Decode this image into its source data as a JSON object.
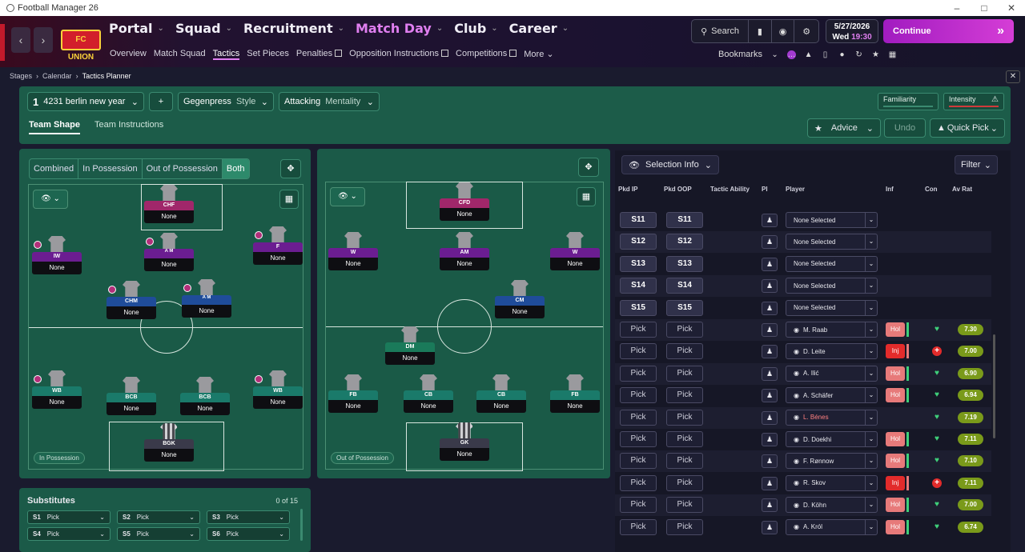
{
  "window": {
    "title": "Football Manager 26"
  },
  "main_menu": [
    {
      "label": "Portal",
      "active": false
    },
    {
      "label": "Squad",
      "active": false
    },
    {
      "label": "Recruitment",
      "active": false
    },
    {
      "label": "Match Day",
      "active": true
    },
    {
      "label": "Club",
      "active": false
    },
    {
      "label": "Career",
      "active": false
    }
  ],
  "club_logo_text": "FC UNION",
  "sub_menu": [
    "Overview",
    "Match Squad",
    "Tactics",
    "Set Pieces",
    "Penalties",
    "Opposition Instructions",
    "Competitions",
    "More"
  ],
  "search_label": "Search",
  "date": {
    "date": "5/27/2026",
    "day": "Wed",
    "time": "19:30"
  },
  "continue_label": "Continue",
  "bookmarks_label": "Bookmarks",
  "breadcrumb": [
    "Stages",
    "Calendar",
    "Tactics Planner"
  ],
  "tactic": {
    "slot": "1",
    "name": "4231 berlin new year",
    "style": "Gegenpress",
    "style_label": "Style",
    "mentality": "Attacking",
    "mentality_label": "Mentality",
    "familiarity_label": "Familiarity",
    "intensity_label": "Intensity"
  },
  "tabs": [
    "Team Shape",
    "Team Instructions"
  ],
  "advice_label": "Advice",
  "undo_label": "Undo",
  "quick_pick_label": "Quick Pick",
  "modes": [
    "Combined",
    "In Possession",
    "Out of Possession",
    "Both"
  ],
  "pitch1": {
    "tag": "In Possession",
    "positions": [
      {
        "role": "CHF",
        "player": "None",
        "color": "#a0276a",
        "dot": false
      },
      {
        "role": "IW",
        "player": "None",
        "color": "#6b1d91",
        "dot": true
      },
      {
        "role": "A\nM",
        "player": "None",
        "color": "#6b1d91",
        "dot": true
      },
      {
        "role": "F",
        "player": "None",
        "color": "#6b1d91",
        "dot": true
      },
      {
        "role": "CHM",
        "player": "None",
        "color": "#1f4c9a",
        "dot": true
      },
      {
        "role": "A\nM",
        "player": "None",
        "color": "#1f4c9a",
        "dot": true
      },
      {
        "role": "WB",
        "player": "None",
        "color": "#1a7a6a",
        "dot": true
      },
      {
        "role": "BCB",
        "player": "None",
        "color": "#1a7a6a",
        "dot": false
      },
      {
        "role": "BCB",
        "player": "None",
        "color": "#1a7a6a",
        "dot": false
      },
      {
        "role": "WB",
        "player": "None",
        "color": "#1a7a6a",
        "dot": true
      },
      {
        "role": "BGK",
        "player": "None",
        "color": "#3a3a4a",
        "dot": false
      }
    ]
  },
  "pitch2": {
    "tag": "Out of Possession",
    "positions": [
      {
        "role": "CFD",
        "player": "None",
        "color": "#a0276a"
      },
      {
        "role": "W",
        "player": "None",
        "color": "#6b1d91"
      },
      {
        "role": "AM",
        "player": "None",
        "color": "#6b1d91"
      },
      {
        "role": "W",
        "player": "None",
        "color": "#6b1d91"
      },
      {
        "role": "CM",
        "player": "None",
        "color": "#1f4c9a"
      },
      {
        "role": "DM",
        "player": "None",
        "color": "#1a7a5a"
      },
      {
        "role": "FB",
        "player": "None",
        "color": "#1a7a6a"
      },
      {
        "role": "CB",
        "player": "None",
        "color": "#1a7a6a"
      },
      {
        "role": "CB",
        "player": "None",
        "color": "#1a7a6a"
      },
      {
        "role": "FB",
        "player": "None",
        "color": "#1a7a6a"
      },
      {
        "role": "GK",
        "player": "None",
        "color": "#3a3a4a"
      }
    ]
  },
  "substitutes": {
    "title": "Substitutes",
    "count": "0 of 15",
    "slots": [
      {
        "slot": "S1",
        "value": "Pick"
      },
      {
        "slot": "S2",
        "value": "Pick"
      },
      {
        "slot": "S3",
        "value": "Pick"
      },
      {
        "slot": "S4",
        "value": "Pick"
      },
      {
        "slot": "S5",
        "value": "Pick"
      },
      {
        "slot": "S6",
        "value": "Pick"
      }
    ]
  },
  "selection_info_label": "Selection Info",
  "filter_label": "Filter",
  "table_headers": [
    "Pkd IP",
    "Pkd OOP",
    "Tactic Ability",
    "PI",
    "Player",
    "Inf",
    "Con",
    "Av Rat"
  ],
  "rows": [
    {
      "ip": "S11",
      "oop": "S11",
      "player": "None Selected",
      "inf": "",
      "con": "",
      "rat": ""
    },
    {
      "ip": "S12",
      "oop": "S12",
      "player": "None Selected",
      "inf": "",
      "con": "",
      "rat": ""
    },
    {
      "ip": "S13",
      "oop": "S13",
      "player": "None Selected",
      "inf": "",
      "con": "",
      "rat": ""
    },
    {
      "ip": "S14",
      "oop": "S14",
      "player": "None Selected",
      "inf": "",
      "con": "",
      "rat": ""
    },
    {
      "ip": "S15",
      "oop": "S15",
      "player": "None Selected",
      "inf": "",
      "con": "",
      "rat": ""
    },
    {
      "ip": "Pick",
      "oop": "Pick",
      "player": "M. Raab",
      "inf": "Hol",
      "con": "heart",
      "rat": "7.30"
    },
    {
      "ip": "Pick",
      "oop": "Pick",
      "player": "D. Leite",
      "inf": "Inj",
      "con": "plus",
      "rat": "7.00"
    },
    {
      "ip": "Pick",
      "oop": "Pick",
      "player": "A. Ilić",
      "inf": "Hol",
      "con": "heart",
      "rat": "6.90"
    },
    {
      "ip": "Pick",
      "oop": "Pick",
      "player": "A. Schäfer",
      "inf": "Hol",
      "con": "heart",
      "rat": "6.94"
    },
    {
      "ip": "Pick",
      "oop": "Pick",
      "player": "L. Bénes",
      "inf": "",
      "con": "heart",
      "rat": "7.19"
    },
    {
      "ip": "Pick",
      "oop": "Pick",
      "player": "D. Doekhi",
      "inf": "Hol",
      "con": "heart",
      "rat": "7.11"
    },
    {
      "ip": "Pick",
      "oop": "Pick",
      "player": "F. Rønnow",
      "inf": "Hol",
      "con": "heart",
      "rat": "7.10"
    },
    {
      "ip": "Pick",
      "oop": "Pick",
      "player": "R. Skov",
      "inf": "Inj",
      "con": "plus",
      "rat": "7.11"
    },
    {
      "ip": "Pick",
      "oop": "Pick",
      "player": "D. Köhn",
      "inf": "Hol",
      "con": "heart",
      "rat": "7.00"
    },
    {
      "ip": "Pick",
      "oop": "Pick",
      "player": "A. Król",
      "inf": "Hol",
      "con": "heart",
      "rat": "6.74"
    }
  ]
}
